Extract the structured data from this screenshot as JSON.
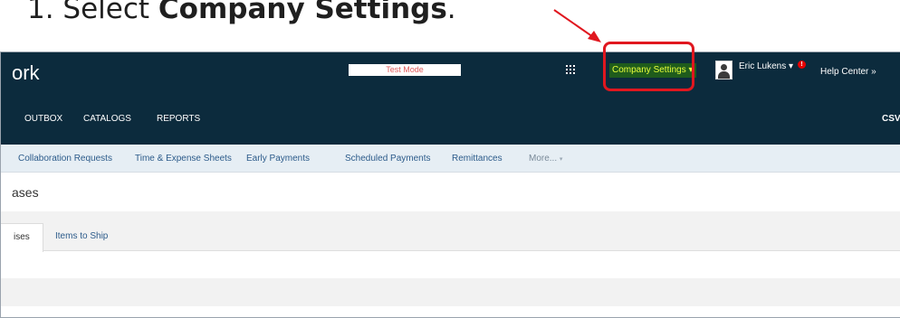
{
  "instruction": {
    "prefix": "1. Select ",
    "emphasis": "Company Settings",
    "suffix": "."
  },
  "topbar": {
    "logo": "ork",
    "test_mode": "Test Mode",
    "company_settings": "Company Settings ▾",
    "user_menu": "Eric Lukens ▾",
    "notification_count": "!",
    "help_center": "Help Center »"
  },
  "navbar": {
    "items": [
      "OUTBOX",
      "CATALOGS",
      "REPORTS"
    ],
    "csv": "CSV"
  },
  "subnav": {
    "items": [
      "Collaboration Requests",
      "Time & Expense Sheets",
      "Early Payments",
      "Scheduled Payments",
      "Remittances"
    ],
    "more": "More..."
  },
  "page": {
    "heading": "ases"
  },
  "tabs": {
    "active": "ises",
    "second": "Items to Ship"
  },
  "colors": {
    "header_bg": "#0c2b3d",
    "company_settings_bg": "#1f5c1c",
    "company_settings_text": "#e8ff3a",
    "highlight": "#e0171f",
    "link": "#2c5b8a"
  }
}
